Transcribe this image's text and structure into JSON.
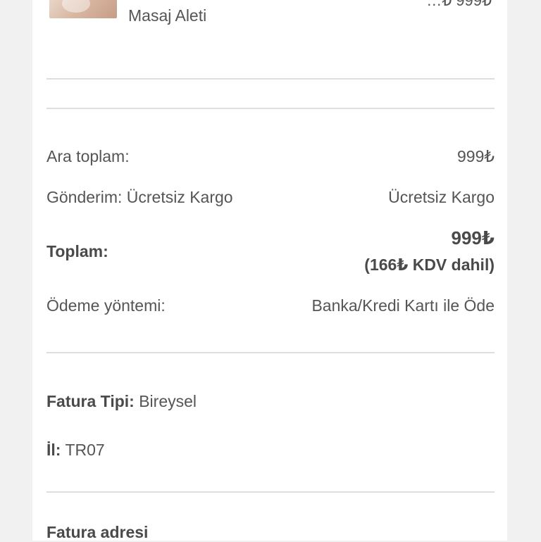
{
  "product": {
    "image_alt": "product-thumbnail",
    "name": "Masaj Aleti",
    "cut_price_partial": "…₺ 999₺"
  },
  "summary": {
    "subtotal_label": "Ara toplam:",
    "subtotal_value": "999₺",
    "shipping_label": "Gönderim: Ücretsiz Kargo",
    "shipping_value": "Ücretsiz Kargo",
    "total_label": "Toplam:",
    "total_value": "999₺",
    "tax_note": "(166₺ KDV dahil)",
    "payment_label": "Ödeme yöntemi:",
    "payment_value": "Banka/Kredi Kartı ile Öde"
  },
  "invoice": {
    "type_label": "Fatura Tipi:",
    "type_value": "Bireysel",
    "province_label": "İl:",
    "province_value": "TR07",
    "address_title": "Fatura adresi"
  },
  "colors": {
    "background": "#f1f1f1",
    "card": "#ffffff",
    "text": "#555555",
    "divider": "#dedede"
  }
}
